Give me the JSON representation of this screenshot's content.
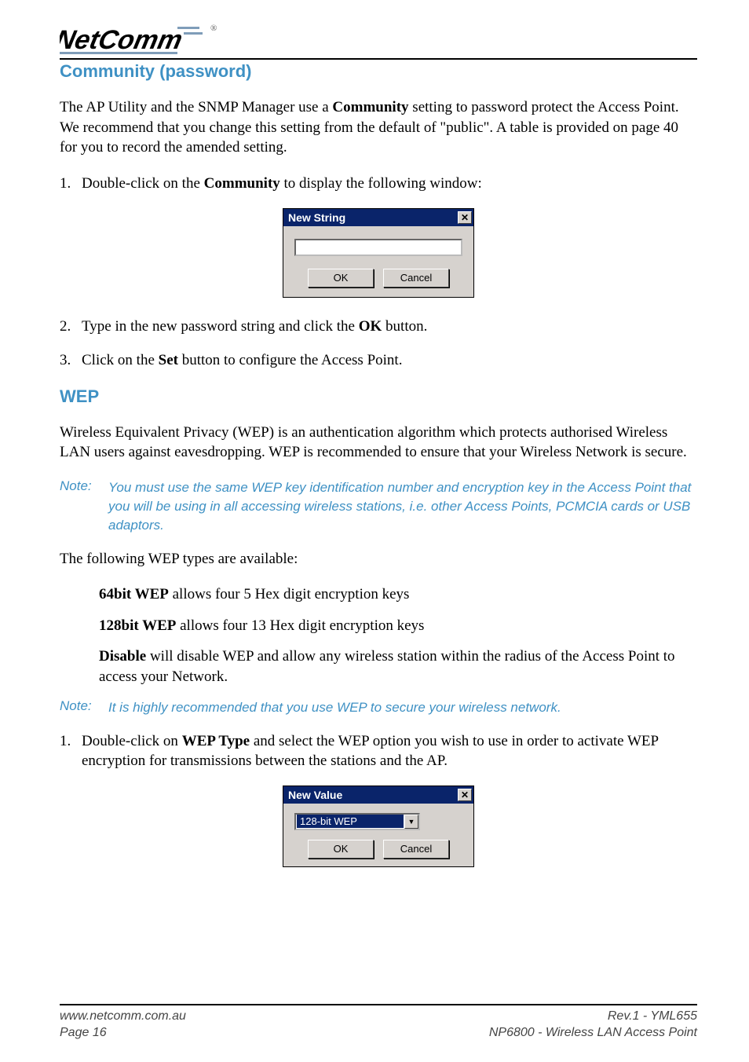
{
  "logo": {
    "brand": "NetComm",
    "reg": "®"
  },
  "section1": {
    "title": "Community (password)",
    "para": "The AP Utility and the SNMP Manager use a <b>Community</b> setting to password protect the Access Point.  We recommend that you change this setting from the default of \"public\".  A table is provided on page 40 for you to record the amended setting.",
    "step1_num": "1.",
    "step1": "Double-click on the <b>Community</b> to display the following window:",
    "step2_num": "2.",
    "step2": "Type in the new password string and click the <b>OK</b> button.",
    "step3_num": "3.",
    "step3": "Click on the <b>Set</b> button to configure the Access Point."
  },
  "dialog1": {
    "title": "New String",
    "close": "✕",
    "ok": "OK",
    "cancel": "Cancel"
  },
  "section2": {
    "title": "WEP",
    "para": "Wireless Equivalent Privacy (WEP) is an authentication algorithm which protects authorised Wireless LAN users against eavesdropping. WEP is recommended to ensure that your Wireless Network is secure.",
    "note1_label": "Note:",
    "note1": "You must use the same WEP key identification number and encryption key in the Access Point that you will be using in all accessing wireless stations, i.e. other Access Points, PCMCIA cards or USB adaptors.",
    "types_intro": "The following WEP types are available:",
    "type_64": "<b>64bit WEP</b> allows four 5 Hex digit encryption keys",
    "type_128": "<b>128bit WEP</b> allows four 13 Hex digit encryption keys",
    "type_disable": "<b>Disable</b> will disable WEP and allow any wireless station within the radius of the Access Point to access your Network.",
    "note2_label": "Note:",
    "note2": "It is highly recommended that you use WEP to secure your wireless network.",
    "step1_num": "1.",
    "step1": "Double-click on <b>WEP Type</b> and select the WEP option you wish to use in order to activate WEP encryption for transmissions between the stations and the AP."
  },
  "dialog2": {
    "title": "New Value",
    "close": "✕",
    "selected": "128-bit WEP",
    "arrow": "▼",
    "ok": "OK",
    "cancel": "Cancel"
  },
  "footer": {
    "left1": "www.netcomm.com.au",
    "left2": "Page 16",
    "right1": "Rev.1 - YML655",
    "right2": "NP6800 - Wireless LAN Access Point"
  }
}
